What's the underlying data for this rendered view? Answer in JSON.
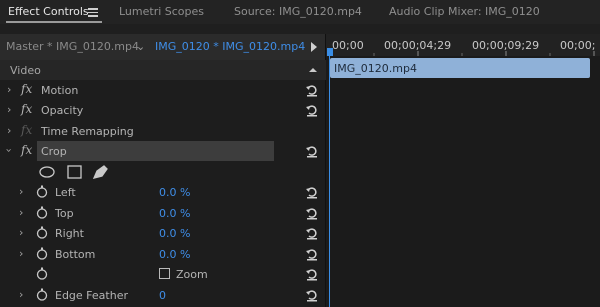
{
  "tabs": [
    {
      "label": "Effect Controls"
    },
    {
      "label": "Lumetri Scopes"
    },
    {
      "label": "Source: IMG_0120.mp4"
    },
    {
      "label": "Audio Clip Mixer: IMG_0120"
    }
  ],
  "header": {
    "master_clip": "Master * IMG_0120.mp4",
    "sequence_clip": "IMG_0120 * IMG_0120.mp4"
  },
  "section": "Video",
  "effects": {
    "motion": "Motion",
    "opacity": "Opacity",
    "time_remapping": "Time Remapping",
    "crop": "Crop"
  },
  "crop_params": [
    {
      "label": "Left",
      "value": "0.0 %"
    },
    {
      "label": "Top",
      "value": "0.0 %"
    },
    {
      "label": "Right",
      "value": "0.0 %"
    },
    {
      "label": "Bottom",
      "value": "0.0 %"
    }
  ],
  "zoom_label": "Zoom",
  "edge_feather": {
    "label": "Edge Feather",
    "value": "0"
  },
  "fx_symbol": "fx",
  "timeline": {
    "ticks": [
      "00;00",
      "00;00;04;29",
      "00;00;09;29",
      "00;00;"
    ],
    "clip_name": "IMG_0120.mp4"
  },
  "colors": {
    "accent": "#3f8ee8",
    "clip": "#8fb1d8",
    "panel_bg": "#1d1d1d"
  }
}
